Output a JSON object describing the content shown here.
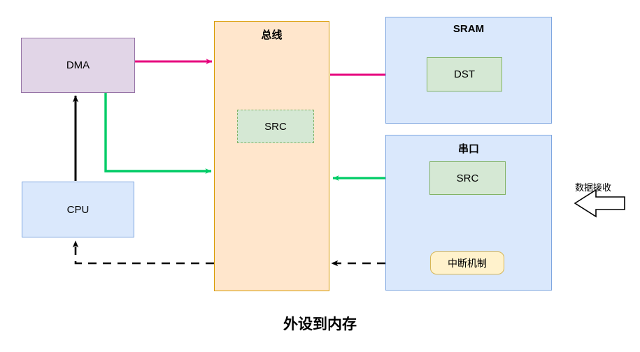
{
  "diagram": {
    "title": "外设到内存",
    "side_annotation": "数据接收",
    "blocks": {
      "dma": "DMA",
      "cpu": "CPU",
      "bus": "总线",
      "bus_src": "SRC",
      "sram": "SRAM",
      "sram_dst": "DST",
      "serial": "串口",
      "serial_src": "SRC",
      "interrupt": "中断机制"
    },
    "colors": {
      "dma_fill": "#e1d5e7",
      "dma_stroke": "#9673a6",
      "cpu_fill": "#dae8fc",
      "cpu_stroke": "#7ea6e0",
      "bus_fill": "#ffe6cc",
      "bus_stroke": "#d79b00",
      "memory_fill": "#d5e8d4",
      "memory_stroke": "#82b366",
      "interrupt_fill": "#fff2cc",
      "interrupt_stroke": "#d6b656",
      "transfer_arrow": "#e6007e",
      "data_arrow": "#00cc66",
      "control_arrow": "#000000"
    },
    "connections": [
      {
        "name": "dma-to-bus",
        "from": "DMA",
        "to": "总线",
        "style": "solid",
        "color": "#e6007e",
        "direction": "one-way"
      },
      {
        "name": "bus-to-sram-dst",
        "from": "总线",
        "to": "DST",
        "style": "solid",
        "color": "#e6007e",
        "direction": "one-way"
      },
      {
        "name": "dma-to-bus-data",
        "from": "DMA",
        "to": "总线",
        "style": "solid",
        "color": "#00cc66",
        "direction": "one-way"
      },
      {
        "name": "bus-to-serial-src",
        "from": "总线",
        "to": "SRC",
        "style": "solid",
        "color": "#00cc66",
        "direction": "two-way"
      },
      {
        "name": "cpu-to-dma",
        "from": "CPU",
        "to": "DMA",
        "style": "solid",
        "color": "#000000",
        "direction": "one-way"
      },
      {
        "name": "interrupt-to-bus-to-cpu",
        "from": "中断机制",
        "to": "CPU",
        "style": "dashed",
        "color": "#000000",
        "direction": "one-way"
      }
    ]
  }
}
